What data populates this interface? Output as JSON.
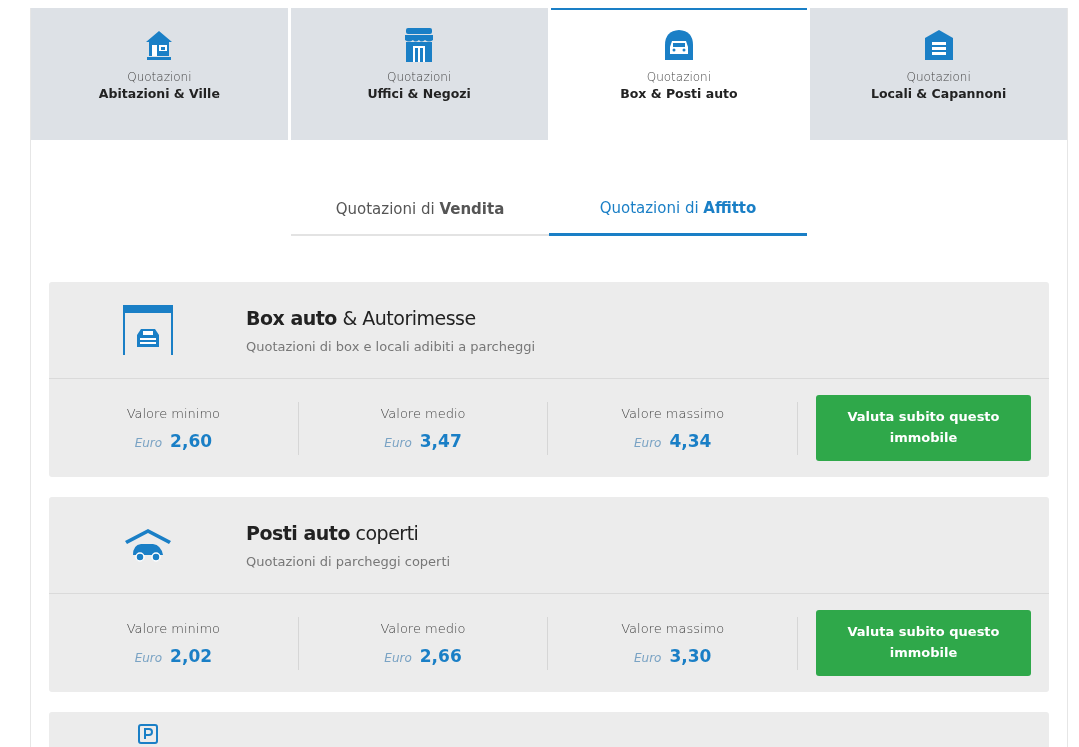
{
  "tabs": [
    {
      "kind": "house",
      "line1": "Quotazioni",
      "line2": "Abitazioni & Ville",
      "selected": false
    },
    {
      "kind": "shop",
      "line1": "Quotazioni",
      "line2": "Uffici & Negozi",
      "selected": false
    },
    {
      "kind": "garage",
      "line1": "Quotazioni",
      "line2": "Box & Posti auto",
      "selected": true
    },
    {
      "kind": "warehouse",
      "line1": "Quotazioni",
      "line2": "Locali & Capannoni",
      "selected": false
    }
  ],
  "subtabs": [
    {
      "label": "Quotazioni di **Vendita**",
      "selected": false
    },
    {
      "label": "Quotazioni di **Affitto**",
      "selected": true
    }
  ],
  "cards": [
    {
      "kind": "box",
      "title": "**Box auto** & Autorimesse",
      "subtitle": "Quotazioni di box e locali adibiti a parcheggi",
      "stats": [
        {
          "label": "Valore minimo",
          "unit": "Euro",
          "value": "2,60"
        },
        {
          "label": "Valore medio",
          "unit": "Euro",
          "value": "3,47"
        },
        {
          "label": "Valore massimo",
          "unit": "Euro",
          "value": "4,34"
        }
      ],
      "button": "Valuta subito questo immobile"
    },
    {
      "kind": "covered",
      "title": "**Posti auto** coperti",
      "subtitle": "Quotazioni di parcheggi coperti",
      "stats": [
        {
          "label": "Valore minimo",
          "unit": "Euro",
          "value": "2,02"
        },
        {
          "label": "Valore medio",
          "unit": "Euro",
          "value": "2,66"
        },
        {
          "label": "Valore massimo",
          "unit": "Euro",
          "value": "3,30"
        }
      ],
      "button": "Valuta subito questo immobile"
    },
    {
      "kind": "parking"
    }
  ]
}
